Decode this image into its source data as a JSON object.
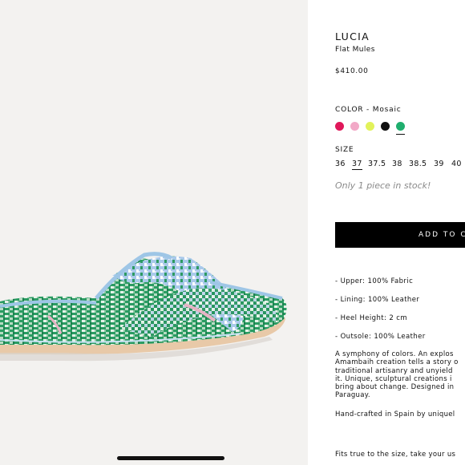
{
  "product": {
    "name": "LUCIA",
    "subtitle": "Flat Mules",
    "price": "$410.00",
    "image_alt": "product-image"
  },
  "color": {
    "label": "COLOR - Mosaic",
    "options": [
      {
        "name": "red",
        "hex": "#e0185a"
      },
      {
        "name": "pink",
        "hex": "#f2a9c7"
      },
      {
        "name": "lime",
        "hex": "#e2f25a"
      },
      {
        "name": "black",
        "hex": "#111111"
      },
      {
        "name": "green",
        "hex": "#1fae6e"
      }
    ],
    "selected": "green"
  },
  "size": {
    "label": "SIZE",
    "options": [
      "36",
      "37",
      "37.5",
      "38",
      "38.5",
      "39",
      "40"
    ],
    "selected": "37"
  },
  "stock_text": "Only 1 piece in stock!",
  "add_to_cart_label": "ADD TO CART",
  "specs": [
    "- Upper: 100% Fabric",
    "- Lining: 100% Leather",
    "- Heel Height: 2 cm",
    "- Outsole: 100% Leather"
  ],
  "description_lines": [
    "A symphony of colors. An explos",
    "Amambaih creation tells a story o",
    "traditional artisanry and unyield",
    "it. Unique, sculptural creations i",
    "bring about change. Designed in",
    "Paraguay."
  ],
  "handmade_text": "Hand-crafted in Spain by uniquel",
  "fit_text": "Fits true to the size, take your us",
  "accent_colors": {
    "button_bg": "#000000",
    "stock_text": "#8a8a8a",
    "image_bg": "#f3f2f0"
  }
}
